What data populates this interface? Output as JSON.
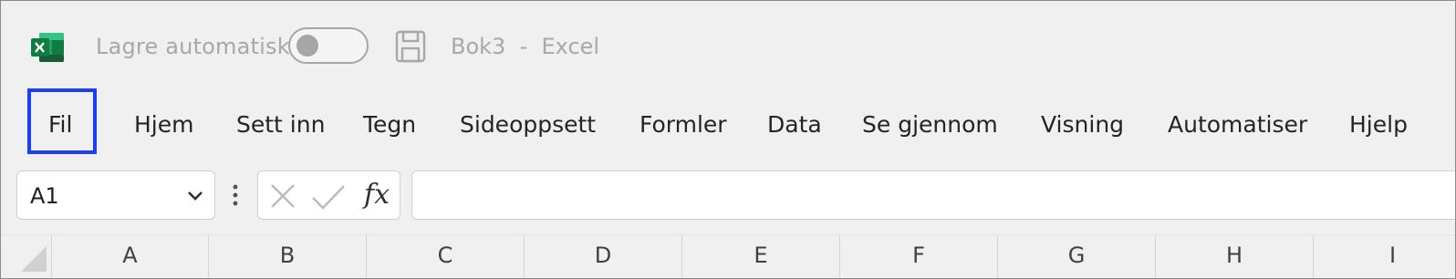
{
  "titlebar": {
    "app_icon": "excel-logo-icon",
    "autosave_label": "Lagre automatisk",
    "autosave_state": "off",
    "save_icon": "save-icon",
    "document_title": "Bok3  -  Excel"
  },
  "ribbon": {
    "tabs": [
      {
        "label": "Fil",
        "highlighted": true
      },
      {
        "label": "Hjem"
      },
      {
        "label": "Sett inn"
      },
      {
        "label": "Tegn"
      },
      {
        "label": "Sideoppsett"
      },
      {
        "label": "Formler"
      },
      {
        "label": "Data"
      },
      {
        "label": "Se gjennom"
      },
      {
        "label": "Visning"
      },
      {
        "label": "Automatiser"
      },
      {
        "label": "Hjelp"
      }
    ],
    "highlight_color": "#1a3ff5"
  },
  "formula_bar": {
    "name_box": "A1",
    "fx_label": "fx",
    "formula_value": ""
  },
  "grid": {
    "columns": [
      "A",
      "B",
      "C",
      "D",
      "E",
      "F",
      "G",
      "H",
      "I"
    ]
  },
  "colors": {
    "excel_green": "#107c41",
    "background": "#f0f0f0"
  }
}
